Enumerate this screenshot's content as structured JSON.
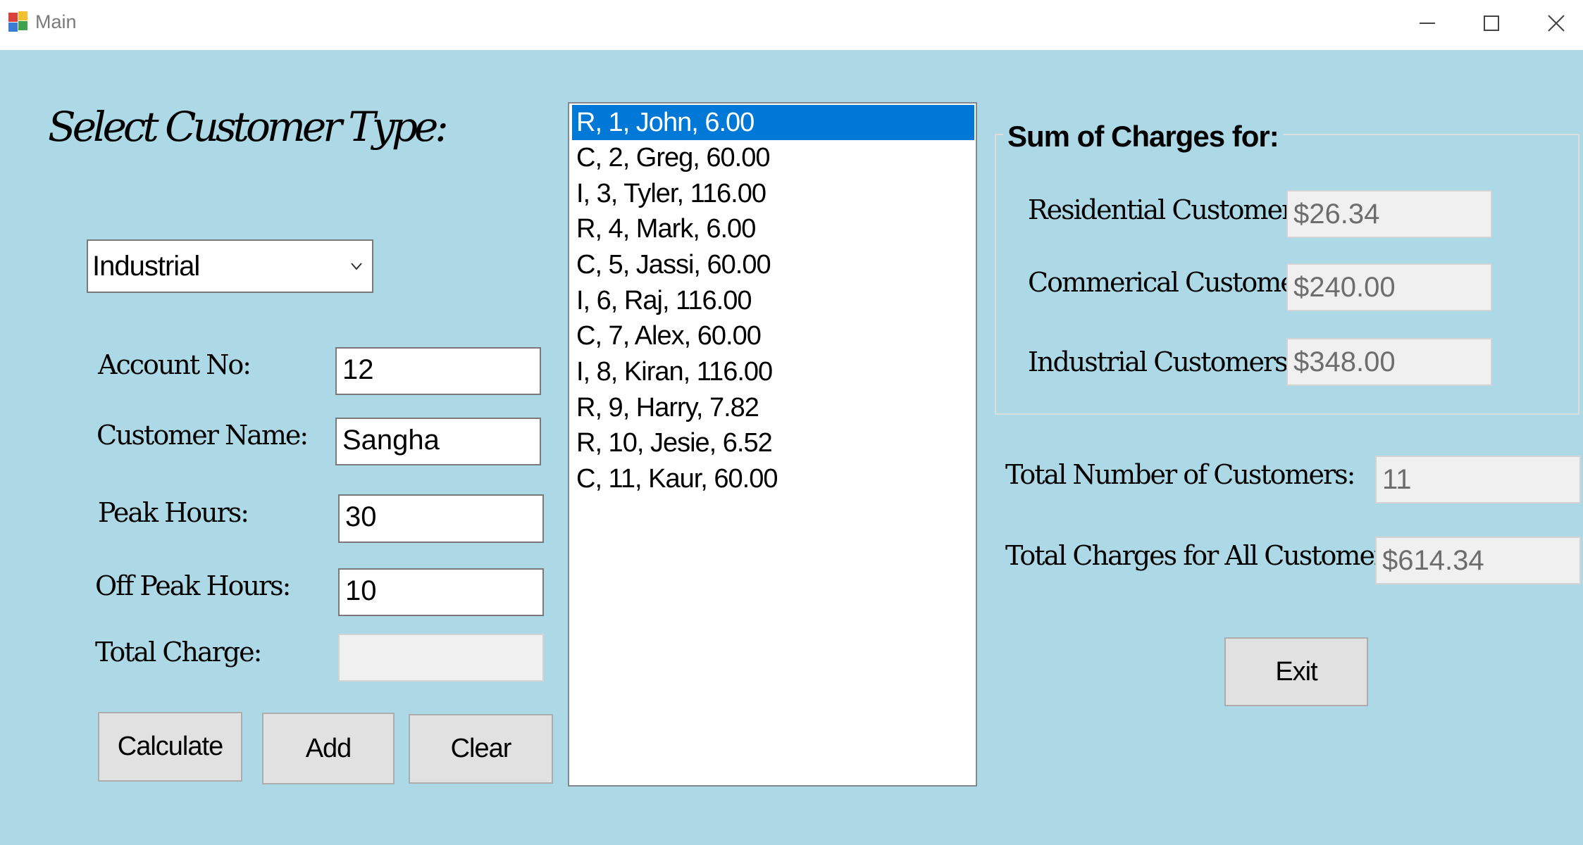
{
  "window": {
    "title": "Main",
    "minimize_icon": "minimize-icon",
    "maximize_icon": "maximize-icon",
    "close_icon": "close-icon"
  },
  "colors": {
    "background": "#add8e6",
    "selection": "#0078d7",
    "button": "#e1e1e1"
  },
  "form": {
    "heading": "Select Customer Type:",
    "customer_type": {
      "selected": "Industrial"
    },
    "account_no": {
      "label": "Account No:",
      "value": "12"
    },
    "customer_name": {
      "label": "Customer Name:",
      "value": "Sangha"
    },
    "peak_hours": {
      "label": "Peak Hours:",
      "value": "30"
    },
    "off_peak_hours": {
      "label": "Off Peak Hours:",
      "value": "10"
    },
    "total_charge": {
      "label": "Total Charge:",
      "value": ""
    },
    "buttons": {
      "calculate": "Calculate",
      "add": "Add",
      "clear": "Clear"
    }
  },
  "customer_list": {
    "items": [
      "R, 1, John, 6.00",
      "C, 2, Greg, 60.00",
      "I, 3, Tyler, 116.00",
      "R, 4, Mark, 6.00",
      "C, 5, Jassi, 60.00",
      "I, 6, Raj, 116.00",
      "C, 7, Alex, 60.00",
      "I, 8, Kiran, 116.00",
      "R, 9, Harry, 7.82",
      "R, 10, Jesie, 6.52",
      "C, 11, Kaur, 60.00"
    ],
    "selected_index": 0
  },
  "summary": {
    "group_title": "Sum of Charges for:",
    "residential": {
      "label": "Residential Customers:",
      "value": "$26.34"
    },
    "commercial": {
      "label": "Commerical Customers:",
      "value": "$240.00"
    },
    "industrial": {
      "label": "Industrial Customers:",
      "value": "$348.00"
    },
    "total_customers": {
      "label": "Total Number of Customers:",
      "value": "11"
    },
    "total_charges": {
      "label": "Total Charges for All Customers:",
      "value": "$614.34"
    },
    "exit_button": "Exit"
  }
}
